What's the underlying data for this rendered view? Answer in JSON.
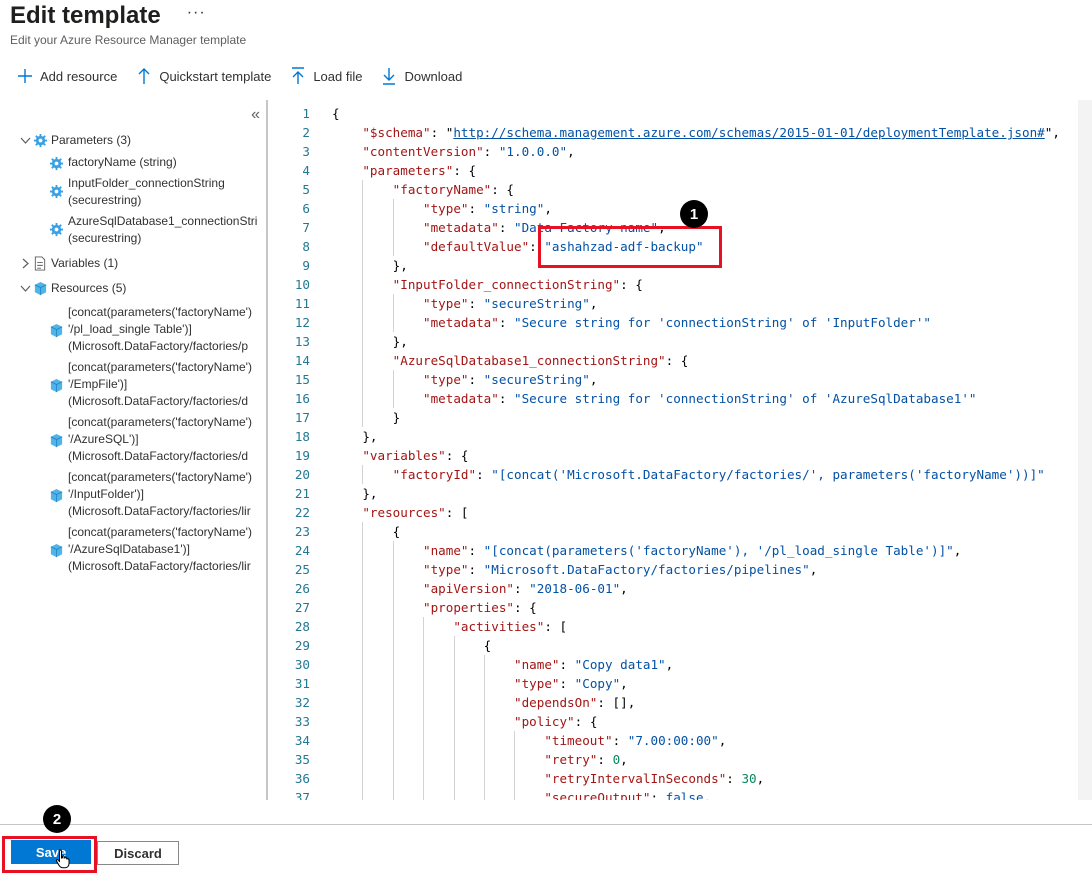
{
  "header": {
    "title": "Edit template",
    "more_label": "···",
    "subtitle": "Edit your Azure Resource Manager template"
  },
  "toolbar": {
    "add_resource": "Add resource",
    "quickstart": "Quickstart template",
    "load_file": "Load file",
    "download": "Download"
  },
  "sidebar": {
    "collapse_label": "«",
    "parameters_label": "Parameters (3)",
    "parameters": [
      [
        "factoryName (string)"
      ],
      [
        "InputFolder_connectionString",
        "(securestring)"
      ],
      [
        "AzureSqlDatabase1_connectionStri",
        "(securestring)"
      ]
    ],
    "variables_label": "Variables (1)",
    "resources_label": "Resources (5)",
    "resources": [
      [
        "[concat(parameters('factoryName')",
        "'/pl_load_single Table')]",
        "(Microsoft.DataFactory/factories/p"
      ],
      [
        "[concat(parameters('factoryName')",
        "'/EmpFile')]",
        "(Microsoft.DataFactory/factories/d"
      ],
      [
        "[concat(parameters('factoryName')",
        "'/AzureSQL')]",
        "(Microsoft.DataFactory/factories/d"
      ],
      [
        "[concat(parameters('factoryName')",
        "'/InputFolder')]",
        "(Microsoft.DataFactory/factories/lir"
      ],
      [
        "[concat(parameters('factoryName')",
        "'/AzureSqlDatabase1')]",
        "(Microsoft.DataFactory/factories/lir"
      ]
    ]
  },
  "editor": {
    "lines": [
      "{",
      "    \"$schema\": \"http://schema.management.azure.com/schemas/2015-01-01/deploymentTemplate.json#\",",
      "    \"contentVersion\": \"1.0.0.0\",",
      "    \"parameters\": {",
      "        \"factoryName\": {",
      "            \"type\": \"string\",",
      "            \"metadata\": \"Data Factory name\",",
      "            \"defaultValue\": \"ashahzad-adf-backup\"",
      "        },",
      "        \"InputFolder_connectionString\": {",
      "            \"type\": \"secureString\",",
      "            \"metadata\": \"Secure string for 'connectionString' of 'InputFolder'\"",
      "        },",
      "        \"AzureSqlDatabase1_connectionString\": {",
      "            \"type\": \"secureString\",",
      "            \"metadata\": \"Secure string for 'connectionString' of 'AzureSqlDatabase1'\"",
      "        }",
      "    },",
      "    \"variables\": {",
      "        \"factoryId\": \"[concat('Microsoft.DataFactory/factories/', parameters('factoryName'))]\"",
      "    },",
      "    \"resources\": [",
      "        {",
      "            \"name\": \"[concat(parameters('factoryName'), '/pl_load_single Table')]\",",
      "            \"type\": \"Microsoft.DataFactory/factories/pipelines\",",
      "            \"apiVersion\": \"2018-06-01\",",
      "            \"properties\": {",
      "                \"activities\": [",
      "                    {",
      "                        \"name\": \"Copy data1\",",
      "                        \"type\": \"Copy\",",
      "                        \"dependsOn\": [],",
      "                        \"policy\": {",
      "                            \"timeout\": \"7.00:00:00\",",
      "                            \"retry\": 0,",
      "                            \"retryIntervalInSeconds\": 30,",
      "                            \"secureOutput\": false,"
    ]
  },
  "callouts": {
    "badge1": "1",
    "badge2": "2"
  },
  "footer": {
    "save_label": "Save",
    "discard_label": "Discard"
  }
}
